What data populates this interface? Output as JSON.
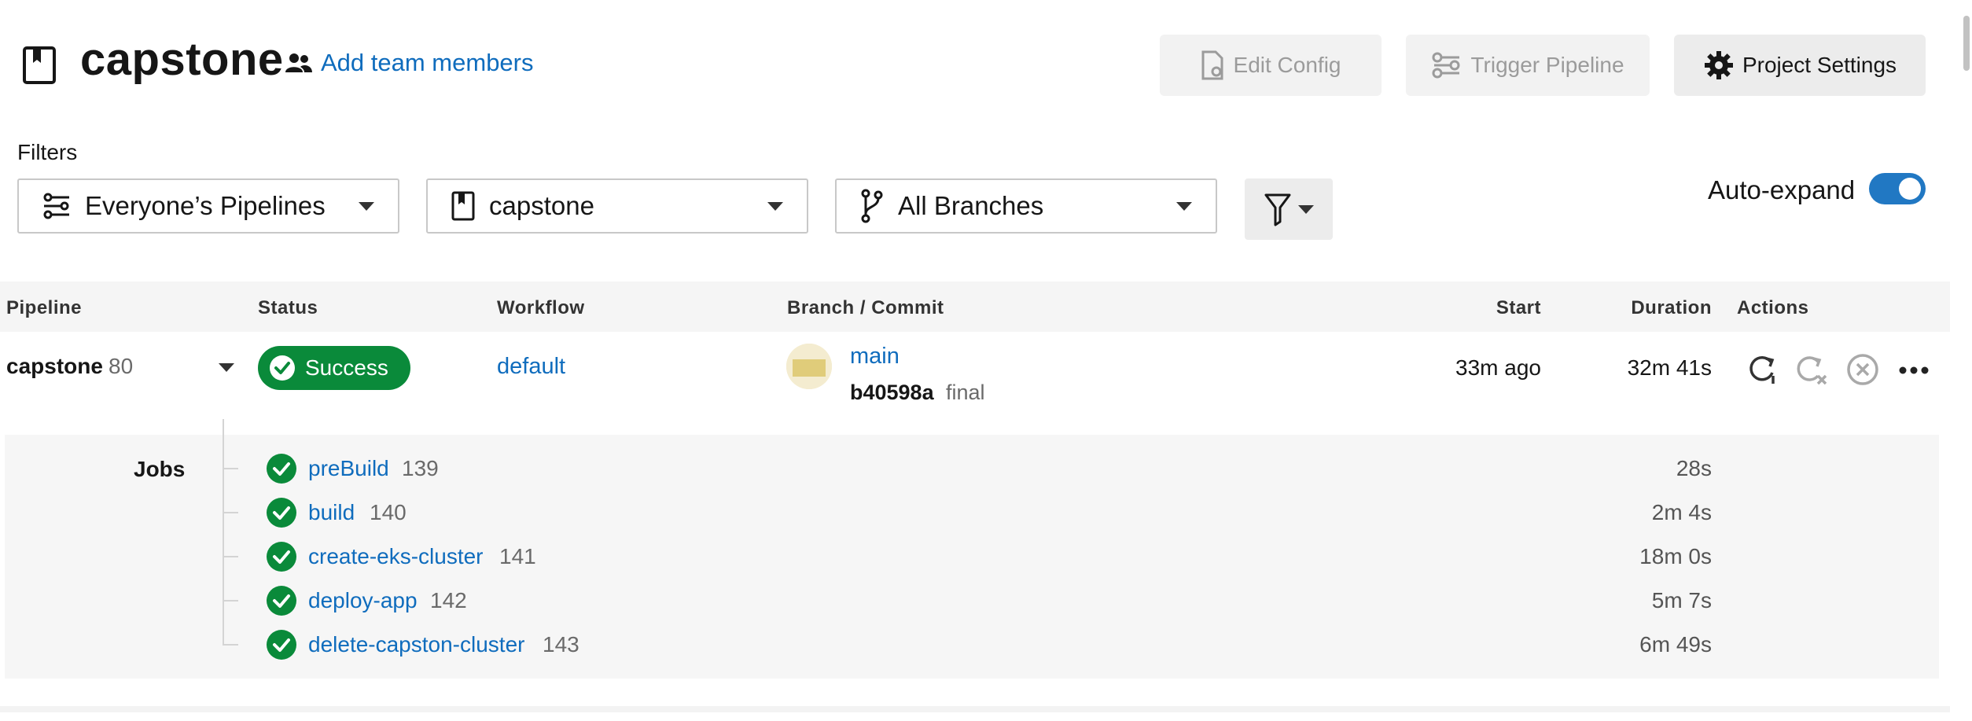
{
  "header": {
    "project_title": "capstone",
    "add_team_label": "Add team members",
    "edit_config_label": "Edit Config",
    "trigger_pipeline_label": "Trigger Pipeline",
    "project_settings_label": "Project Settings"
  },
  "filters": {
    "label": "Filters",
    "pipelines_value": "Everyone’s Pipelines",
    "project_value": "capstone",
    "branches_value": "All Branches",
    "auto_expand_label": "Auto-expand",
    "auto_expand_on": true
  },
  "table": {
    "headers": {
      "pipeline": "Pipeline",
      "status": "Status",
      "workflow": "Workflow",
      "branch_commit": "Branch / Commit",
      "start": "Start",
      "duration": "Duration",
      "actions": "Actions"
    },
    "row": {
      "pipeline_name": "capstone",
      "pipeline_number": "80",
      "status": "Success",
      "workflow": "default",
      "branch": "main",
      "commit_sha": "b40598a",
      "commit_message": "final",
      "start": "33m ago",
      "duration": "32m 41s"
    }
  },
  "jobs": {
    "label": "Jobs",
    "items": [
      {
        "name": "preBuild",
        "number": "139",
        "duration": "28s"
      },
      {
        "name": "build",
        "number": "140",
        "duration": "2m 4s"
      },
      {
        "name": "create-eks-cluster",
        "number": "141",
        "duration": "18m 0s"
      },
      {
        "name": "deploy-app",
        "number": "142",
        "duration": "5m 7s"
      },
      {
        "name": "delete-capston-cluster",
        "number": "143",
        "duration": "6m 49s"
      }
    ]
  },
  "colors": {
    "success_green": "#0a8a3a",
    "link_blue": "#0f6cbd",
    "toggle_blue": "#2178c3"
  }
}
